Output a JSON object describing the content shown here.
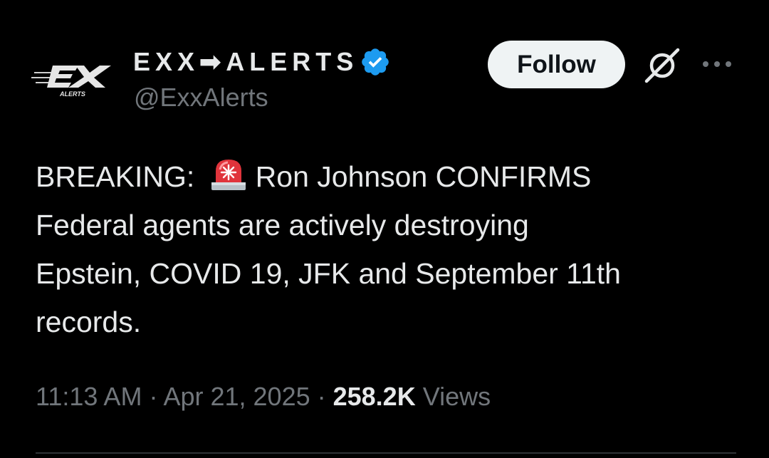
{
  "author": {
    "display_name": "EXX➡ALERTS",
    "handle": "@ExxAlerts",
    "avatar_text": "ALERTS",
    "avatar_mark": "EX",
    "verified": true,
    "verified_color": "#1d9bf0"
  },
  "actions": {
    "follow_label": "Follow",
    "grok_icon": "grok-icon",
    "more_icon": "more-icon"
  },
  "tweet": {
    "lines": [
      {
        "before_emoji": "BREAKING: ",
        "emoji": "siren",
        "after_emoji": "Ron Johnson CONFIRMS"
      },
      {
        "text": "Federal agents are actively destroying"
      },
      {
        "text": "Epstein, COVID 19, JFK and September 11th"
      },
      {
        "text": "records."
      }
    ]
  },
  "meta": {
    "time": "11:13 AM",
    "separator": " · ",
    "date": "Apr 21, 2025",
    "views_count": "258.2K",
    "views_label": " Views"
  },
  "colors": {
    "background": "#000000",
    "text_primary": "#e7e9ea",
    "text_secondary": "#71767b",
    "follow_bg": "#eff3f4",
    "divider": "#2f3336"
  }
}
